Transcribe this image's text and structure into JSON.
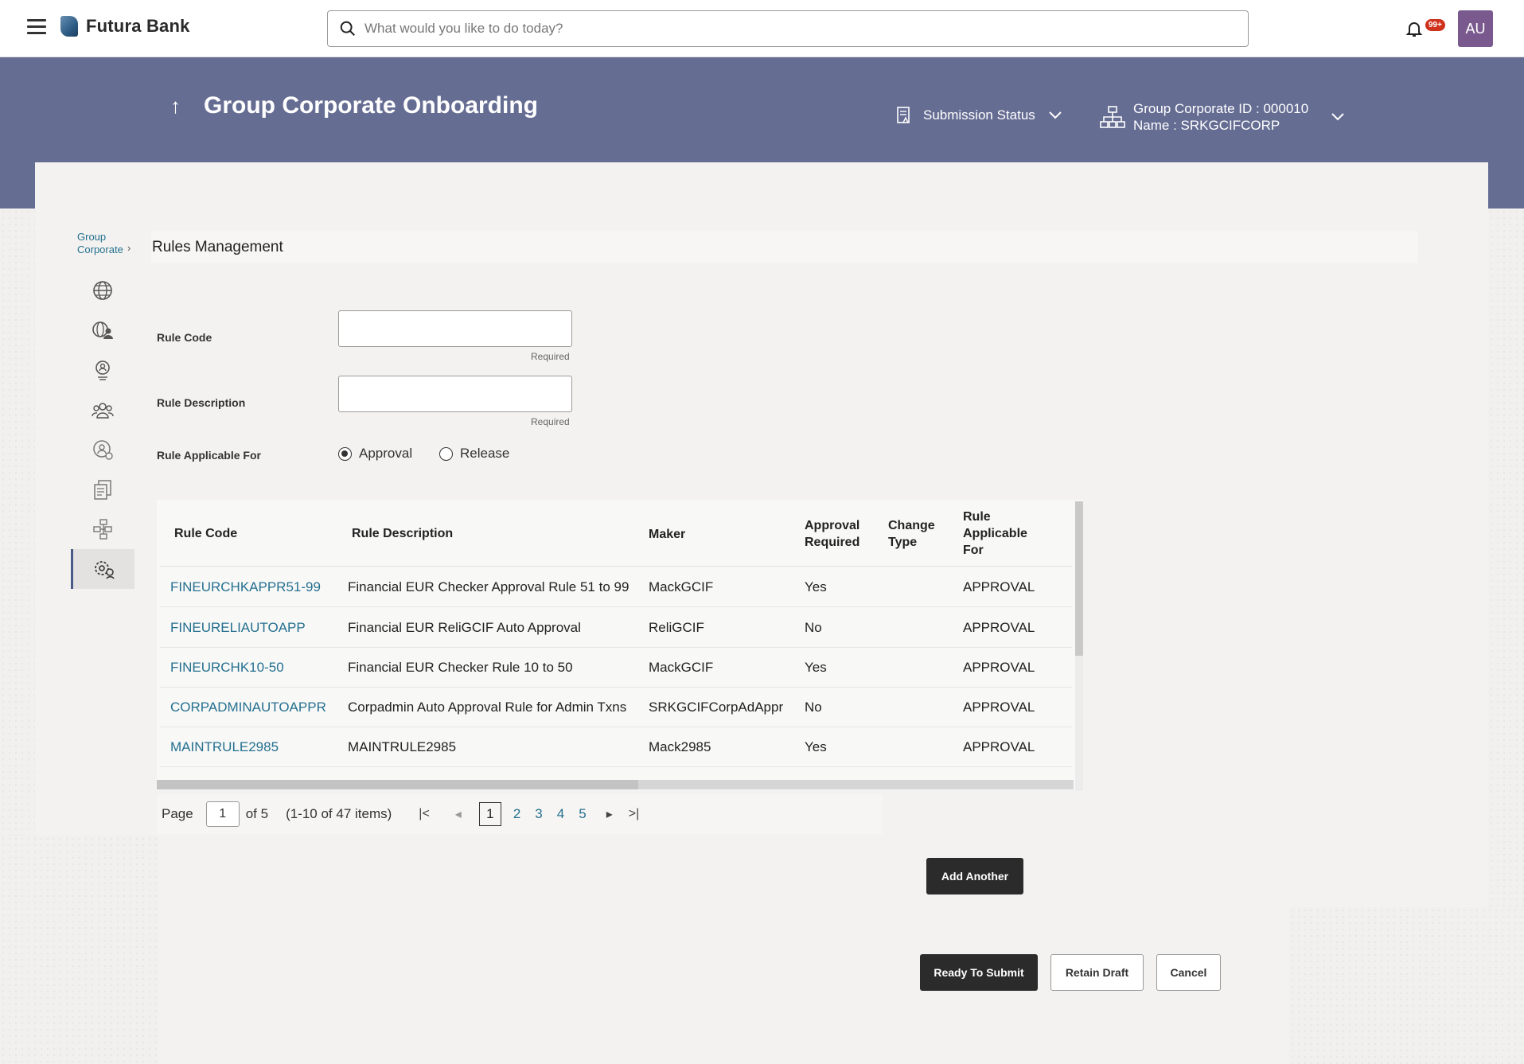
{
  "app": {
    "name": "Futura Bank"
  },
  "search": {
    "placeholder": "What would you like to do today?"
  },
  "notifications": {
    "badge": "99+"
  },
  "user": {
    "initials": "AU"
  },
  "header": {
    "title": "Group Corporate Onboarding",
    "submission_status": "Submission Status",
    "group_corporate_id": "Group Corporate ID : 000010",
    "group_corporate_name": "Name : SRKGCIFCORP"
  },
  "breadcrumb": {
    "line1": "Group",
    "line2": "Corporate"
  },
  "section": {
    "title": "Rules Management"
  },
  "form": {
    "rule_code_label": "Rule Code",
    "rule_description_label": "Rule Description",
    "rule_applicable_label": "Rule Applicable For",
    "required_text": "Required",
    "rule_code_value": "",
    "rule_description_value": "",
    "options": [
      "Approval",
      "Release"
    ],
    "selected_option": "Approval"
  },
  "table": {
    "headers": {
      "rule_code": "Rule Code",
      "rule_description": "Rule Description",
      "maker": "Maker",
      "approval_required_1": "Approval",
      "approval_required_2": "Required",
      "change_type_1": "Change",
      "change_type_2": "Type",
      "applicable_1": "Rule",
      "applicable_2": "Applicable",
      "applicable_3": "For"
    },
    "rows": [
      {
        "code": "FINEURCHKAPPR51-99",
        "description": "Financial EUR Checker Approval Rule 51 to 99",
        "maker": "MackGCIF",
        "approval": "Yes",
        "change_type": "",
        "applicable": "APPROVAL"
      },
      {
        "code": "FINEURELIAUTOAPP",
        "description": "Financial EUR ReliGCIF Auto Approval",
        "maker": "ReliGCIF",
        "approval": "No",
        "change_type": "",
        "applicable": "APPROVAL"
      },
      {
        "code": "FINEURCHK10-50",
        "description": "Financial EUR Checker Rule 10 to 50",
        "maker": "MackGCIF",
        "approval": "Yes",
        "change_type": "",
        "applicable": "APPROVAL"
      },
      {
        "code": "CORPADMINAUTOAPPR",
        "description": "Corpadmin Auto Approval Rule for Admin Txns",
        "maker": "SRKGCIFCorpAdAppr",
        "approval": "No",
        "change_type": "",
        "applicable": "APPROVAL"
      },
      {
        "code": "MAINTRULE2985",
        "description": "MAINTRULE2985",
        "maker": "Mack2985",
        "approval": "Yes",
        "change_type": "",
        "applicable": "APPROVAL"
      }
    ]
  },
  "pagination": {
    "page_label": "Page",
    "current_page": "1",
    "of_text": "of 5",
    "items_text": "(1-10 of 47 items)",
    "pages": [
      "1",
      "2",
      "3",
      "4",
      "5"
    ]
  },
  "buttons": {
    "add_another": "Add Another",
    "ready_to_submit": "Ready To Submit",
    "retain_draft": "Retain Draft",
    "cancel": "Cancel"
  },
  "colors": {
    "header_band": "#666d93",
    "link": "#25708f",
    "primary_button": "#2b2b2b",
    "notification_badge": "#d0311d",
    "avatar": "#7a5a8e"
  },
  "icons": {
    "nav": [
      "globe-icon",
      "globe-user-icon",
      "location-user-icon",
      "group-users-icon",
      "user-settings-icon",
      "documents-icon",
      "workflow-icon",
      "rules-settings-icon"
    ]
  }
}
